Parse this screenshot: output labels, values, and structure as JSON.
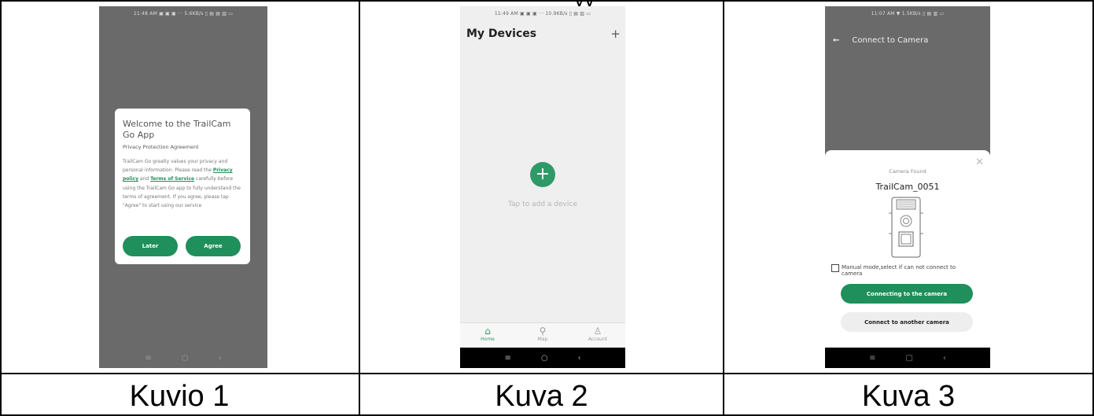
{
  "captions": [
    "Kuvio 1",
    "Kuva 2",
    "Kuva 3"
  ],
  "top_cut_text": "yy",
  "screen1": {
    "status": "11:48 AM ▣ ▣ ▣ ···   5.6KB/s ▯ ▤ ▤ ▥ ▭",
    "title": "Welcome to the TrailCam Go App",
    "subtitle": "Privacy Protection Agreement",
    "body_pre": "TrailCam Go greatly values your privacy and personal information. Please read the ",
    "link_privacy": "Privacy policy",
    "body_and": " and ",
    "link_terms": "Terms of Service",
    "body_post": " carefully before using the TrailCam Go app to fully understand the terms of agreement. If you agree, please tap \"Agree\" to start using our service",
    "later": "Later",
    "agree": "Agree",
    "nav": [
      "≡",
      "○",
      "‹"
    ]
  },
  "screen2": {
    "status": "11:49 AM ▣ ▣ ▣ ···   10.9KB/s ▯ ▤ ▥ ▭",
    "title": "My Devices",
    "plus": "+",
    "add_symbol": "+",
    "hint": "Tap to add a device",
    "tabs": [
      {
        "label": "Home",
        "icon": "⌂"
      },
      {
        "label": "Map",
        "icon": "⚲"
      },
      {
        "label": "Account",
        "icon": "♙"
      }
    ],
    "nav": [
      "≡",
      "○",
      "‹"
    ]
  },
  "screen3": {
    "status": "11:07 AM ▼        1.5KB/s ▯ ▤ ▥ ▭",
    "back": "←",
    "header": "Connect to Camera",
    "close": "✕",
    "found_label": "Camera Found",
    "camera_name": "TrailCam_0051",
    "manual_text": "Manual mode,select if can not connect to camera",
    "btn_connecting": "Connecting to the camera",
    "btn_other": "Connect to another camera",
    "nav": [
      "≡",
      "▢",
      "‹"
    ]
  }
}
